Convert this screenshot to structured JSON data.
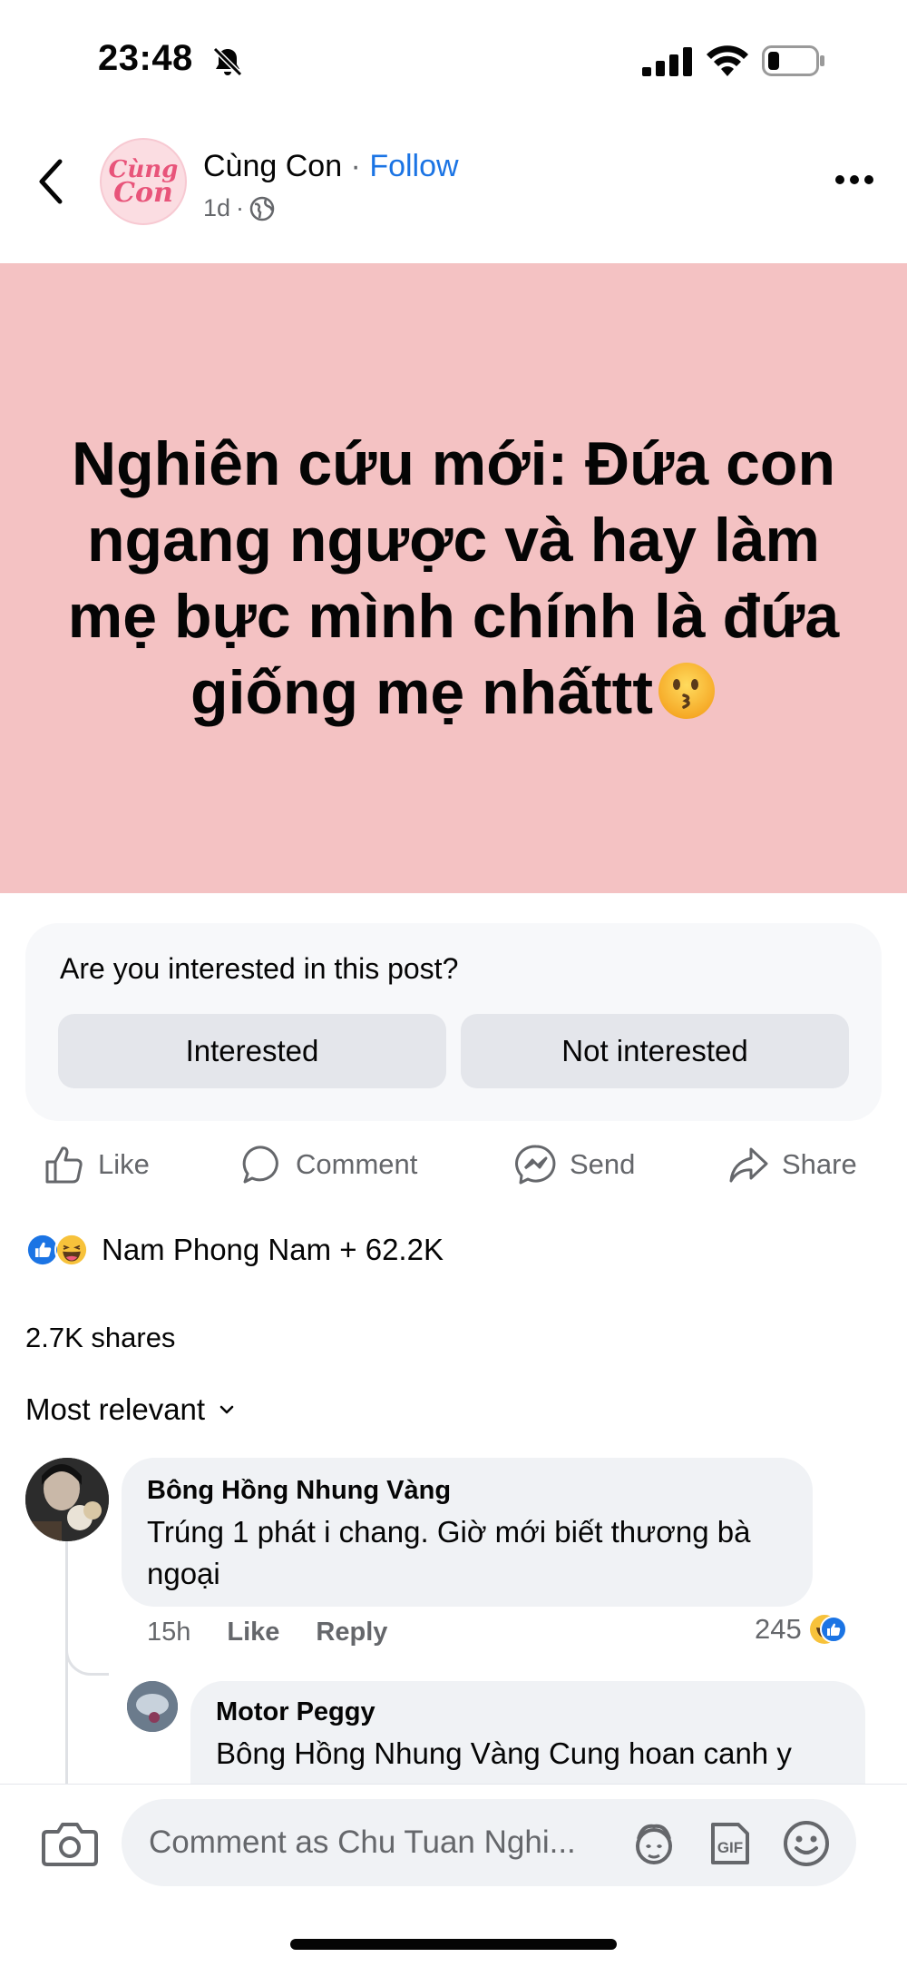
{
  "status_bar": {
    "time": "23:48",
    "icons": [
      "bell-off-icon",
      "signal-icon",
      "wifi-icon",
      "battery-icon"
    ]
  },
  "header": {
    "avatar_text_line1": "Cùng",
    "avatar_text_line2": "Con",
    "page_name": "Cùng Con",
    "separator": " · ",
    "follow_label": "Follow",
    "time_ago": "1d",
    "meta_separator": "·",
    "privacy_icon": "globe-icon"
  },
  "post": {
    "banner_text": "Nghiên cứu mới: Đứa con ngang ngược và hay làm mẹ bực mình chính là đứa giống mẹ nhấttt",
    "banner_emoji": "kissing-face-emoji",
    "banner_bg": "#f4c2c3"
  },
  "interest_prompt": {
    "question": "Are you interested in this post?",
    "interested_label": "Interested",
    "not_interested_label": "Not interested"
  },
  "actions": {
    "like": "Like",
    "comment": "Comment",
    "send": "Send",
    "share": "Share"
  },
  "reactions": {
    "summary": "Nam Phong Nam + 62.2K",
    "icons": [
      "like-reaction-icon",
      "haha-reaction-icon"
    ]
  },
  "shares": "2.7K shares",
  "sort": {
    "label": "Most relevant"
  },
  "comments": [
    {
      "author": "Bông Hồng Nhung Vàng",
      "text": "Trúng 1 phát i chang. Giờ mới biết thương bà ngoại",
      "time": "15h",
      "like_label": "Like",
      "reply_label": "Reply",
      "reaction_count": "245"
    },
    {
      "author": "Motor Peggy",
      "text": "Bông Hồng Nhung Vàng Cung hoan  canh y"
    }
  ],
  "composer": {
    "placeholder": "Comment as Chu Tuan Nghi..."
  },
  "colors": {
    "accent": "#1b74e4",
    "secondary_text": "#65676b",
    "bubble": "#f0f2f5"
  }
}
